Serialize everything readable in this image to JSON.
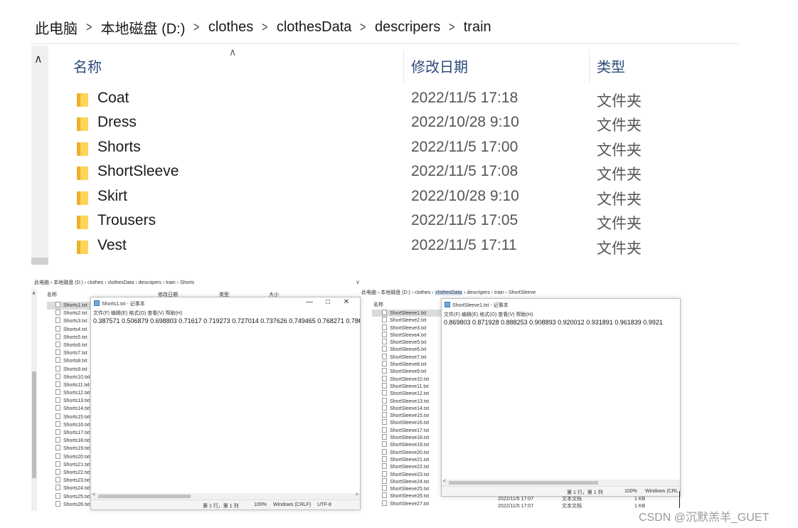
{
  "main_explorer": {
    "breadcrumb": [
      "此电脑",
      "本地磁盘 (D:)",
      "clothes",
      "clothesData",
      "descripers",
      "train"
    ],
    "columns": {
      "name": "名称",
      "modified": "修改日期",
      "type": "类型"
    },
    "folders": [
      {
        "name": "Coat",
        "modified": "2022/11/5 17:18",
        "type": "文件夹"
      },
      {
        "name": "Dress",
        "modified": "2022/10/28 9:10",
        "type": "文件夹"
      },
      {
        "name": "Shorts",
        "modified": "2022/11/5 17:00",
        "type": "文件夹"
      },
      {
        "name": "ShortSleeve",
        "modified": "2022/11/5 17:08",
        "type": "文件夹"
      },
      {
        "name": "Skirt",
        "modified": "2022/10/28 9:10",
        "type": "文件夹"
      },
      {
        "name": "Trousers",
        "modified": "2022/11/5 17:05",
        "type": "文件夹"
      },
      {
        "name": "Vest",
        "modified": "2022/11/5 17:11",
        "type": "文件夹"
      }
    ]
  },
  "shorts_explorer": {
    "breadcrumb_text": "此电脑 › 本地磁盘 (D:) › clothes › clothesData › descripers › train › Shorts",
    "columns": {
      "name": "名称",
      "modified": "修改日期",
      "type": "类型",
      "size": "大小"
    },
    "files": [
      "Shorts1.txt",
      "Shorts2.txt",
      "Shorts3.txt",
      "Shorts4.txt",
      "Shorts5.txt",
      "Shorts6.txt",
      "Shorts7.txt",
      "Shorts8.txt",
      "Shorts9.txt",
      "Shorts10.txt",
      "Shorts11.txt",
      "Shorts12.txt",
      "Shorts13.txt",
      "Shorts14.txt",
      "Shorts15.txt",
      "Shorts16.txt",
      "Shorts17.txt",
      "Shorts18.txt",
      "Shorts19.txt",
      "Shorts20.txt",
      "Shorts21.txt",
      "Shorts22.txt",
      "Shorts23.txt",
      "Shorts24.txt",
      "Shorts25.txt",
      "Shorts26.txt"
    ]
  },
  "notepad_shorts": {
    "title": "Shorts1.txt - 记事本",
    "menu": [
      "文件(F)",
      "编辑(E)",
      "格式(O)",
      "查看(V)",
      "帮助(H)"
    ],
    "content": "0.387571 0.506879 0.698803 0.71617 0.719273 0.727014 0.737626 0.749465 0.768271 0.78€",
    "status": {
      "position": "第 1 行，第 1 列",
      "zoom": "100%",
      "eol": "Windows (CRLF)",
      "encoding": "UTF-8"
    }
  },
  "shortsleeve_explorer": {
    "breadcrumb": {
      "before": "此电脑 › 本地磁盘 (D:) › clothes › ",
      "highlight": "clothesData",
      "after": " › descripers › train › ShortSleeve"
    },
    "columns": {
      "name": "名称"
    },
    "files": [
      "ShortSleeve1.txt",
      "ShortSleeve2.txt",
      "ShortSleeve3.txt",
      "ShortSleeve4.txt",
      "ShortSleeve5.txt",
      "ShortSleeve6.txt",
      "ShortSleeve7.txt",
      "ShortSleeve8.txt",
      "ShortSleeve9.txt",
      "ShortSleeve10.txt",
      "ShortSleeve11.txt",
      "ShortSleeve12.txt",
      "ShortSleeve13.txt",
      "ShortSleeve14.txt",
      "ShortSleeve15.txt",
      "ShortSleeve16.txt",
      "ShortSleeve17.txt",
      "ShortSleeve18.txt",
      "ShortSleeve19.txt",
      "ShortSleeve20.txt",
      "ShortSleeve21.txt",
      "ShortSleeve22.txt",
      "ShortSleeve23.txt",
      "ShortSleeve24.txt",
      "ShortSleeve25.txt",
      "ShortSleeve26.txt",
      "ShortSleeve27.txt"
    ],
    "under_rows": [
      {
        "modified": "2022/11/5 17:07",
        "type": "文本文档",
        "size": "1 KB"
      },
      {
        "modified": "2022/11/5 17:07",
        "type": "文本文档",
        "size": "1 KB"
      }
    ]
  },
  "notepad_shortsleeve": {
    "title": "ShortSleeve1.txt - 记事本",
    "menu": [
      "文件(F)",
      "编辑(E)",
      "格式(O)",
      "查看(V)",
      "帮助(H)"
    ],
    "content": "0.869803 0.871928 0.888253 0.908893 0.920012 0.931891 0.961839 0.9921",
    "status": {
      "position": "第 1 行，第 1 列",
      "zoom": "100%",
      "eol": "Windows (CRL"
    }
  },
  "watermark": "CSDN @沉默羔羊_GUET"
}
